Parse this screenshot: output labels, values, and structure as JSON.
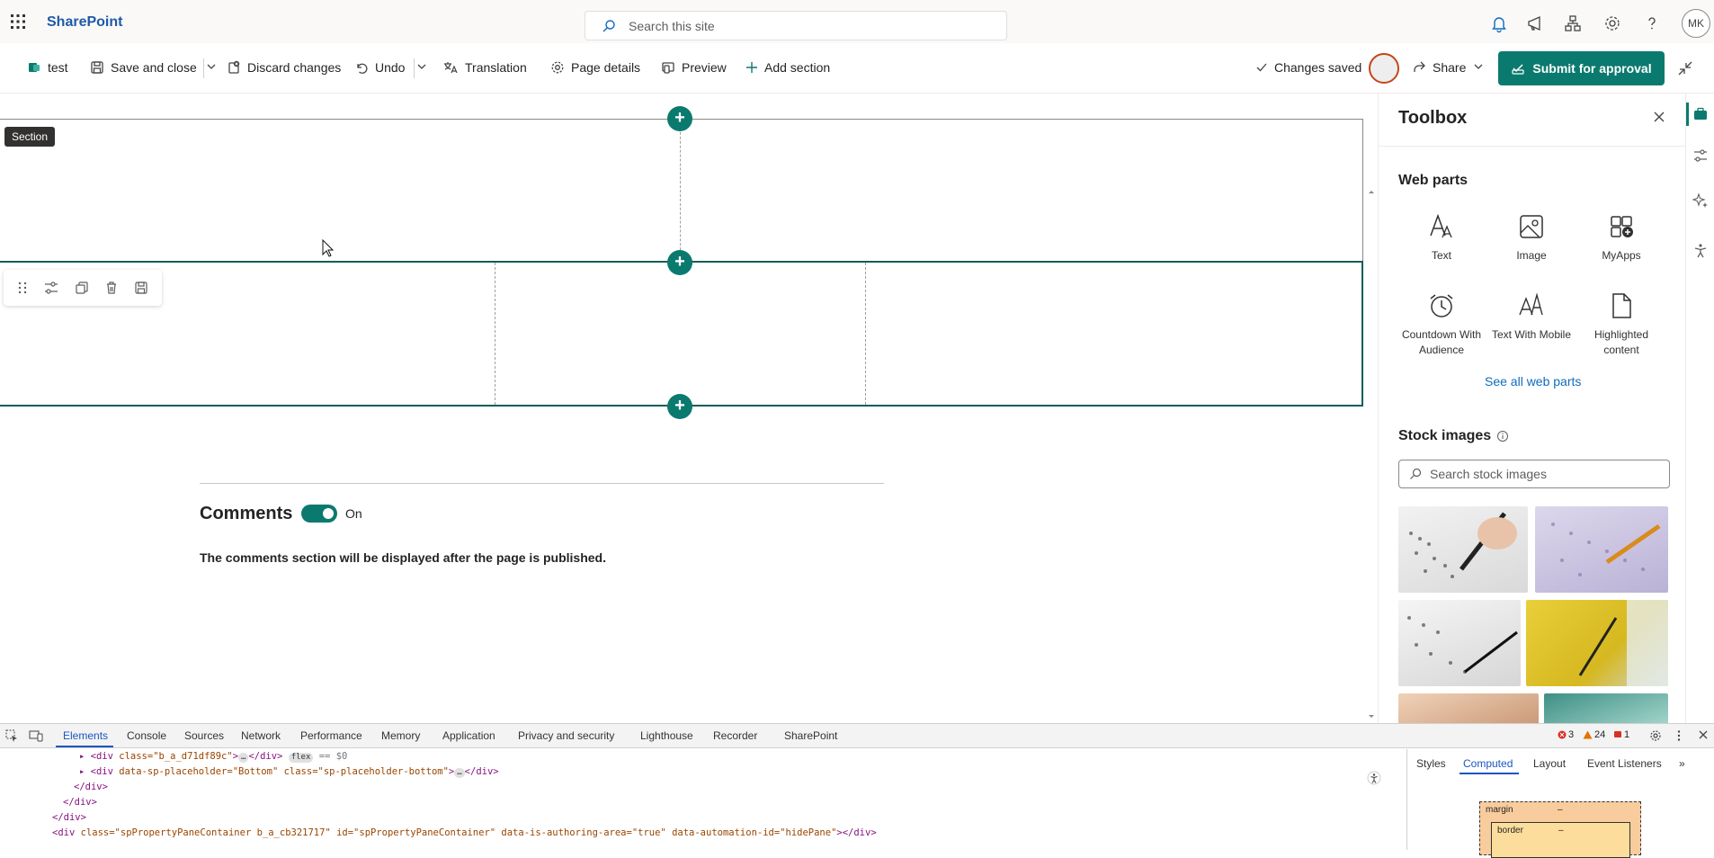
{
  "suite": {
    "brand": "SharePoint",
    "search_placeholder": "Search this site",
    "user_initials": "MK"
  },
  "command_bar": {
    "page_name": "test",
    "save_close": "Save and close",
    "discard": "Discard changes",
    "undo": "Undo",
    "translation": "Translation",
    "page_details": "Page details",
    "preview": "Preview",
    "add_section": "Add section",
    "status": "Changes saved",
    "share": "Share",
    "submit": "Submit for approval"
  },
  "canvas": {
    "section_tooltip": "Section",
    "comments_title": "Comments",
    "comments_toggle_state": "On",
    "comments_note": "The comments section will be displayed after the page is published."
  },
  "toolbox": {
    "title": "Toolbox",
    "webparts_heading": "Web parts",
    "webparts": [
      {
        "label": "Text",
        "icon": "text-icon"
      },
      {
        "label": "Image",
        "icon": "image-icon"
      },
      {
        "label": "MyApps",
        "icon": "apps-icon"
      },
      {
        "label": "Countdown With Audience",
        "icon": "clock-icon"
      },
      {
        "label": "Text With Mobile",
        "icon": "text-mobile-icon"
      },
      {
        "label": "Highlighted content",
        "icon": "document-icon"
      }
    ],
    "see_all": "See all web parts",
    "stock_heading": "Stock images",
    "stock_search_placeholder": "Search stock images"
  },
  "devtools": {
    "tabs": [
      "Elements",
      "Console",
      "Sources",
      "Network",
      "Performance",
      "Memory",
      "Application",
      "Privacy and security",
      "Lighthouse",
      "Recorder",
      "SharePoint"
    ],
    "active_tab": "Elements",
    "errors": "3",
    "warnings": "24",
    "issues": "1",
    "dom_lines": [
      {
        "tag": "div",
        "attrs": "class=\"b_a_d71df89c\"",
        "extra": "flex",
        "suffix": "== $0"
      },
      {
        "tag": "div",
        "attrs": "data-sp-placeholder=\"Bottom\" class=\"sp-placeholder-bottom\"",
        "extra": "",
        "suffix": ""
      },
      {
        "tag": "/div",
        "attrs": "",
        "extra": "",
        "suffix": ""
      },
      {
        "tag": "/div",
        "attrs": "",
        "extra": "",
        "suffix": ""
      },
      {
        "tag": "/div",
        "attrs": "",
        "extra": "",
        "suffix": ""
      },
      {
        "tag": "div",
        "attrs": "class=\"spPropertyPaneContainer b_a_cb321717\" id=\"spPropertyPaneContainer\" data-is-authoring-area=\"true\" data-automation-id=\"hidePane\"",
        "extra": "",
        "suffix": ""
      }
    ],
    "side_tabs": [
      "Styles",
      "Computed",
      "Layout",
      "Event Listeners"
    ],
    "active_side_tab": "Computed",
    "box_margin": "margin",
    "box_border": "border",
    "box_dash": "–"
  },
  "colors": {
    "accent": "#0b7a6e",
    "brand_blue": "#1e5aa8",
    "link": "#0f6cbd"
  }
}
